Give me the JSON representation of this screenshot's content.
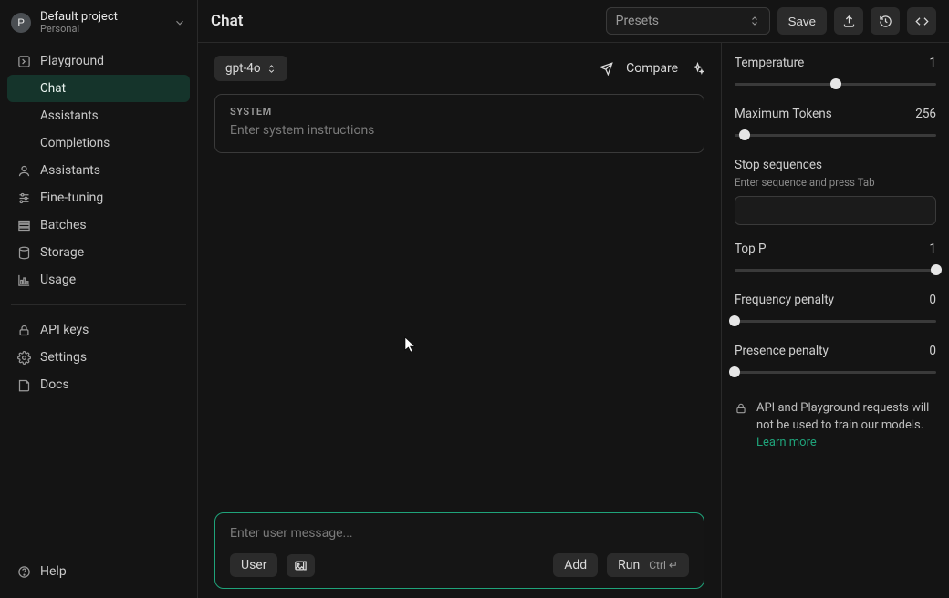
{
  "project": {
    "avatar_letter": "P",
    "name": "Default project",
    "subtitle": "Personal"
  },
  "sidebar": {
    "playground_label": "Playground",
    "chat_label": "Chat",
    "assistants_sub_label": "Assistants",
    "completions_label": "Completions",
    "assistants_label": "Assistants",
    "fine_tuning_label": "Fine-tuning",
    "batches_label": "Batches",
    "storage_label": "Storage",
    "usage_label": "Usage",
    "api_keys_label": "API keys",
    "settings_label": "Settings",
    "docs_label": "Docs",
    "help_label": "Help"
  },
  "header": {
    "title": "Chat",
    "presets_placeholder": "Presets",
    "save_label": "Save"
  },
  "chat": {
    "model": "gpt-4o",
    "compare_label": "Compare",
    "system_label": "SYSTEM",
    "system_placeholder": "Enter system instructions"
  },
  "composer": {
    "placeholder": "Enter user message...",
    "user_label": "User",
    "add_label": "Add",
    "run_label": "Run",
    "run_shortcut": "Ctrl ↵"
  },
  "settings": {
    "temperature": {
      "label": "Temperature",
      "value": "1",
      "pos": 50
    },
    "max_tokens": {
      "label": "Maximum Tokens",
      "value": "256",
      "pos": 5
    },
    "stop": {
      "label": "Stop sequences",
      "hint": "Enter sequence and press Tab"
    },
    "top_p": {
      "label": "Top P",
      "value": "1",
      "pos": 100
    },
    "freq": {
      "label": "Frequency penalty",
      "value": "0",
      "pos": 0
    },
    "pres": {
      "label": "Presence penalty",
      "value": "0",
      "pos": 0
    },
    "notice_text": "API and Playground requests will not be used to train our models.",
    "learn_more": "Learn more"
  }
}
